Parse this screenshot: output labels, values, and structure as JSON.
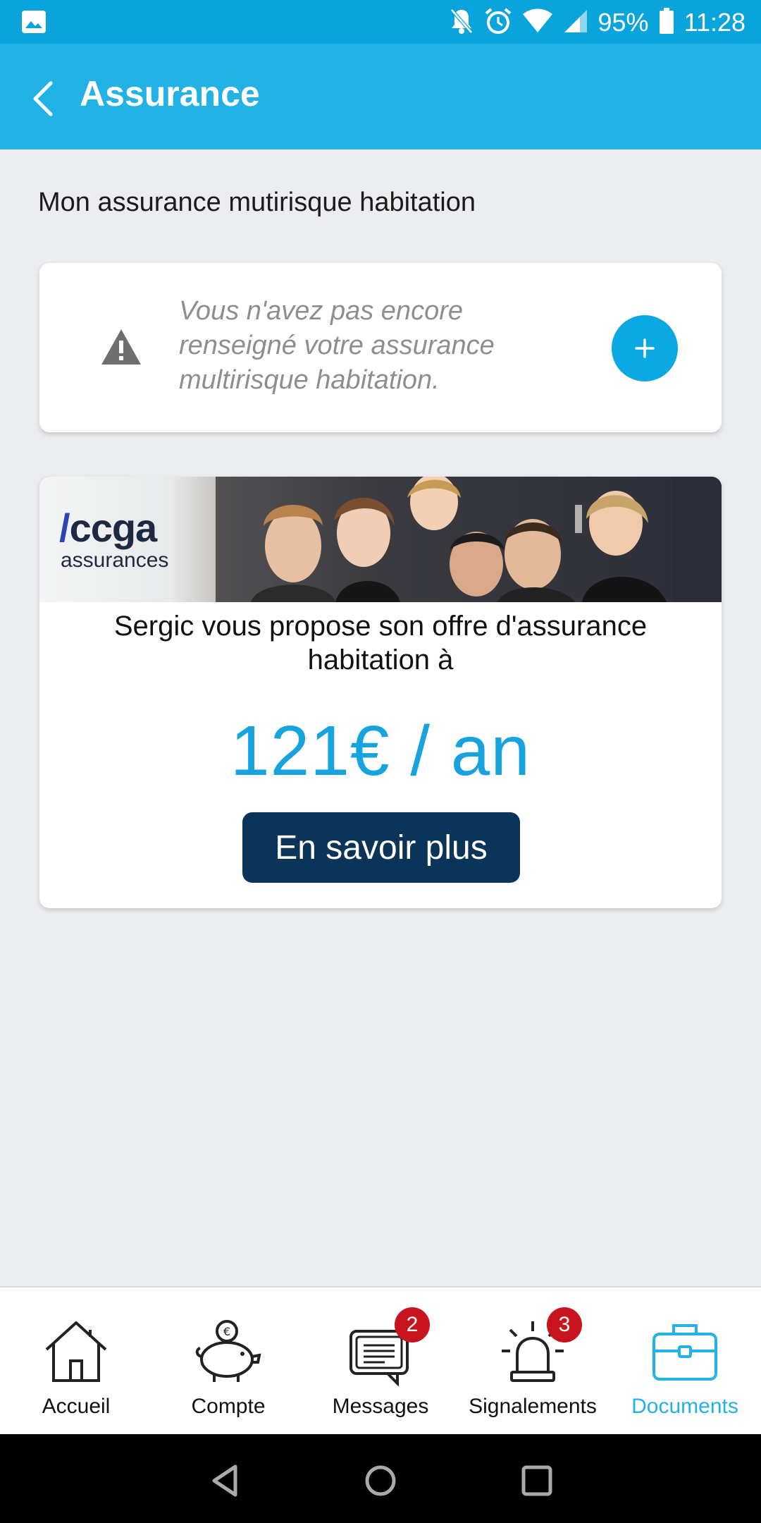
{
  "status_bar": {
    "battery": "95%",
    "time": "11:28",
    "icons": [
      "image-icon",
      "notifications-off-icon",
      "alarm-icon",
      "wifi-icon",
      "signal-icon",
      "battery-icon"
    ]
  },
  "app_bar": {
    "title": "Assurance",
    "back_icon": "chevron-left-icon"
  },
  "main": {
    "section_title": "Mon assurance mutirisque habitation",
    "warning_card": {
      "icon": "warning-icon",
      "message": "Vous n'avez pas encore renseigné votre assurance multirisque habitation.",
      "add_icon": "plus-icon"
    },
    "offer_card": {
      "brand_mark": "/",
      "brand_name": "ccga",
      "brand_sub": "assurances",
      "description": "Sergic vous propose son offre d'assurance habitation à",
      "price": "121€ / an",
      "cta_label": "En savoir plus"
    }
  },
  "bottom_nav": {
    "items": [
      {
        "label": "Accueil",
        "icon": "home-icon",
        "badge": ""
      },
      {
        "label": "Compte",
        "icon": "piggy-bank-icon",
        "badge": ""
      },
      {
        "label": "Messages",
        "icon": "messages-icon",
        "badge": "2"
      },
      {
        "label": "Signalements",
        "icon": "alarm-light-icon",
        "badge": "3"
      },
      {
        "label": "Documents",
        "icon": "briefcase-icon",
        "badge": ""
      }
    ],
    "active": "Documents"
  },
  "colors": {
    "status_bar": "#0aa4dc",
    "app_bar": "#23b2e6",
    "accent": "#17a3dd",
    "cta": "#0c3358",
    "badge": "#c8141e"
  }
}
